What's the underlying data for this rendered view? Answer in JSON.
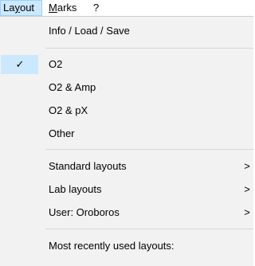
{
  "menubar": {
    "items": [
      {
        "label_pre": "La",
        "label_underline": "y",
        "label_post": "out"
      },
      {
        "label_pre": "",
        "label_underline": "M",
        "label_post": "arks"
      },
      {
        "label_pre": "?",
        "label_underline": "",
        "label_post": ""
      }
    ]
  },
  "dropdown": {
    "info_load_save": "Info / Load / Save",
    "o2": "O2",
    "o2_amp": "O2 & Amp",
    "o2_px": "O2 & pX",
    "other": "Other",
    "standard_layouts": "Standard layouts",
    "lab_layouts": "Lab layouts",
    "user_oroboros": "User: Oroboros",
    "most_recent_header": "Most recently used layouts:",
    "submenu_arrow": ">",
    "check_mark": "✓"
  },
  "colors": {
    "menu_background": "#f2f2f2",
    "highlight": "#cce8ff",
    "highlight_border": "#99d1ff"
  },
  "icons": {
    "check": "check-icon",
    "submenu": "chevron-right-icon"
  }
}
